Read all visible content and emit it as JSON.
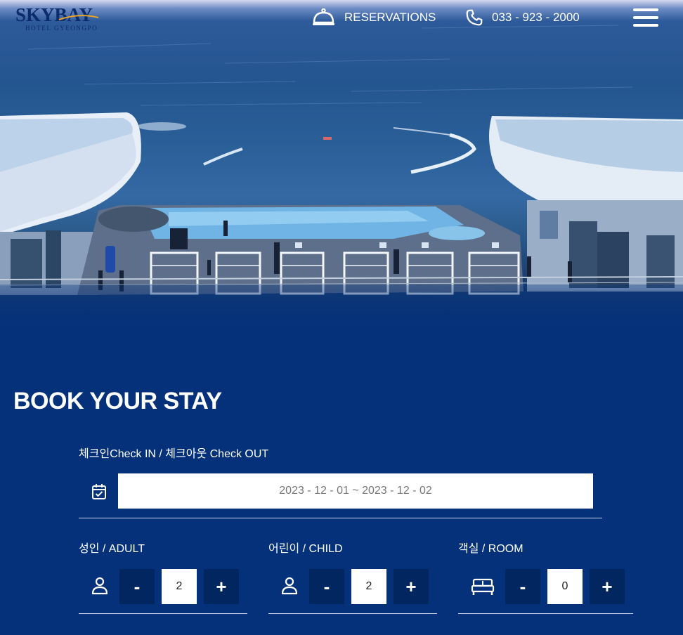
{
  "header": {
    "logo": {
      "brand": "SKYBAY",
      "subtitle": "HOTEL GYEONGPO",
      "color": "#0b2b6d"
    },
    "reservations": {
      "icon": "room-service-bell-icon",
      "label": "RESERVATIONS"
    },
    "phone": {
      "icon": "phone-icon",
      "label": "033 - 923 - 2000"
    },
    "menu_icon": "hamburger-menu-icon"
  },
  "hero": {
    "description_icon": "hotel-rooftop-pool-photo"
  },
  "booking": {
    "title": "BOOK YOUR STAY",
    "date_label": "체크인Check IN / 체크아웃 Check OUT",
    "date_icon": "calendar-check-icon",
    "date_value": "2023 - 12 - 01 ~ 2023 - 12 - 02",
    "adult": {
      "label": "성인 / ADULT",
      "icon": "person-icon",
      "minus": "-",
      "plus": "+",
      "value": "2"
    },
    "child": {
      "label": "어린이 / CHILD",
      "icon": "person-icon",
      "minus": "-",
      "plus": "+",
      "value": "2"
    },
    "room": {
      "label": "객실 / ROOM",
      "icon": "bed-icon",
      "minus": "-",
      "plus": "+",
      "value": "0"
    }
  },
  "colors": {
    "background": "#04317a",
    "stepper_button": "#022660",
    "text": "#ffffff"
  }
}
